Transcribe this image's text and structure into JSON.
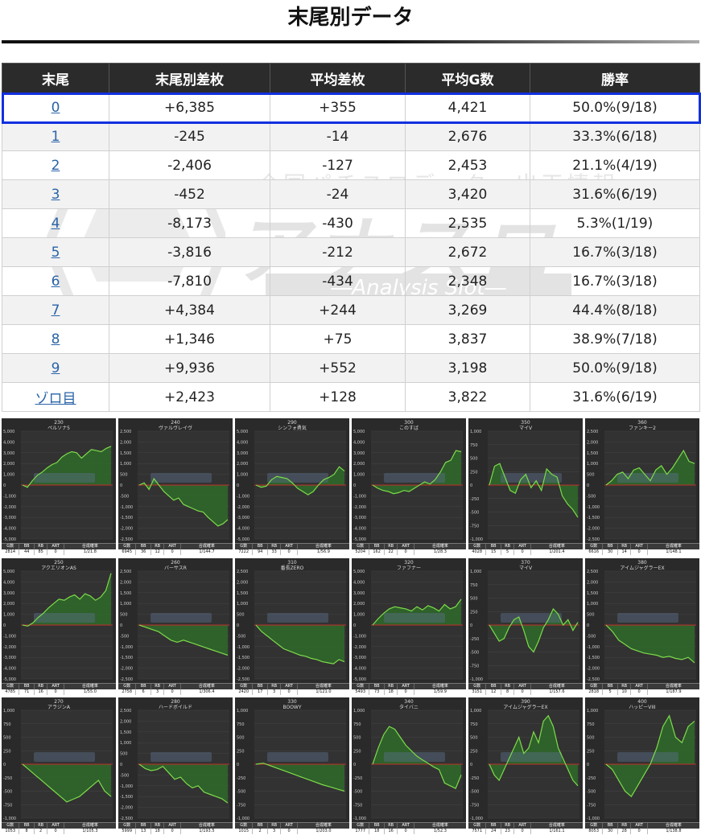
{
  "page": {
    "title": "末尾別データ"
  },
  "table": {
    "headers": [
      "末尾",
      "末尾別差枚",
      "平均差枚",
      "平均G数",
      "勝率"
    ],
    "rows": [
      {
        "tail": "0",
        "total": "+6,385",
        "avg": "+355",
        "games": "4,421",
        "win": "50.0%(9/18)"
      },
      {
        "tail": "1",
        "total": "-245",
        "avg": "-14",
        "games": "2,676",
        "win": "33.3%(6/18)"
      },
      {
        "tail": "2",
        "total": "-2,406",
        "avg": "-127",
        "games": "2,453",
        "win": "21.1%(4/19)"
      },
      {
        "tail": "3",
        "total": "-452",
        "avg": "-24",
        "games": "3,420",
        "win": "31.6%(6/19)"
      },
      {
        "tail": "4",
        "total": "-8,173",
        "avg": "-430",
        "games": "2,535",
        "win": "5.3%(1/19)"
      },
      {
        "tail": "5",
        "total": "-3,816",
        "avg": "-212",
        "games": "2,672",
        "win": "16.7%(3/18)"
      },
      {
        "tail": "6",
        "total": "-7,810",
        "avg": "-434",
        "games": "2,348",
        "win": "16.7%(3/18)"
      },
      {
        "tail": "7",
        "total": "+4,384",
        "avg": "+244",
        "games": "3,269",
        "win": "44.4%(8/18)"
      },
      {
        "tail": "8",
        "total": "+1,346",
        "avg": "+75",
        "games": "3,837",
        "win": "38.9%(7/18)"
      },
      {
        "tail": "9",
        "total": "+9,936",
        "avg": "+552",
        "games": "3,198",
        "win": "50.0%(9/18)"
      },
      {
        "tail": "ゾロ目",
        "total": "+2,423",
        "avg": "+128",
        "games": "3,822",
        "win": "31.6%(6/19)"
      }
    ]
  },
  "watermark": {
    "top_text": "全国パチスロデータ・出玉情報",
    "logo_text": "アナスロ",
    "sub_text": "―Analysis Slot―"
  },
  "colors": {
    "header_bg": "#2b2b2b",
    "highlight_border": "#1230e0",
    "link": "#2a63a8",
    "chart_bg": "#2a2a2a",
    "chart_line": "#7ddc4a",
    "chart_fill": "#2f6a2a",
    "zero_line": "#c0302a"
  },
  "footer_headers": [
    "G数",
    "BB",
    "RB",
    "ART",
    "合成確率"
  ],
  "chart_data": [
    {
      "type": "area",
      "machine_no": "230",
      "title": "ペルソナ5",
      "yticks": [
        "5,000",
        "4,000",
        "3,000",
        "2,000",
        "1,000",
        "0",
        "-1,000",
        "-2,000",
        "-3,000",
        "-4,000",
        "-5,000"
      ],
      "ylim": [
        -5000,
        5000
      ],
      "values": [
        0,
        -200,
        400,
        900,
        1200,
        1600,
        1900,
        2100,
        2600,
        2900,
        3100,
        3000,
        2500,
        2900,
        3300,
        3200,
        3100,
        3400,
        3600
      ],
      "stats": [
        "2814",
        "44",
        "85",
        "0",
        "1/21.8"
      ]
    },
    {
      "type": "area",
      "machine_no": "240",
      "title": "ヴァルヴレイヴ",
      "yticks": [
        "2,500",
        "2,000",
        "1,500",
        "1,000",
        "500",
        "0",
        "-500",
        "-1,000",
        "-1,500",
        "-2,000",
        "-2,500"
      ],
      "ylim": [
        -2500,
        2500
      ],
      "values": [
        0,
        100,
        -200,
        300,
        0,
        -300,
        -500,
        -700,
        -600,
        -900,
        -1000,
        -1100,
        -1200,
        -1250,
        -1500,
        -1700,
        -1900,
        -1800,
        -1600
      ],
      "stats": [
        "6945",
        "36",
        "12",
        "0",
        "1/144.7"
      ]
    },
    {
      "type": "area",
      "machine_no": "290",
      "title": "シンフォ勇気",
      "yticks": [
        "5,000",
        "4,000",
        "3,000",
        "2,000",
        "1,000",
        "0",
        "-1,000",
        "-2,000",
        "-3,000",
        "-4,000",
        "-5,000"
      ],
      "ylim": [
        -5000,
        5000
      ],
      "values": [
        0,
        -200,
        -100,
        500,
        800,
        700,
        600,
        200,
        -300,
        -600,
        -900,
        -600,
        0,
        500,
        700,
        1000,
        1700,
        1300
      ],
      "stats": [
        "7222",
        "94",
        "33",
        "0",
        "1/56.9"
      ]
    },
    {
      "type": "area",
      "machine_no": "300",
      "title": "このすば",
      "yticks": [
        "5,000",
        "4,000",
        "3,000",
        "2,000",
        "1,000",
        "0",
        "-1,000",
        "-2,000",
        "-3,000",
        "-4,000",
        "-5,000"
      ],
      "ylim": [
        -5000,
        5000
      ],
      "values": [
        0,
        -300,
        -500,
        -600,
        -800,
        -700,
        -500,
        -600,
        -300,
        0,
        300,
        100,
        500,
        1200,
        2100,
        2300,
        3200,
        3100
      ],
      "stats": [
        "5204",
        "162",
        "22",
        "0",
        "1/28.3"
      ]
    },
    {
      "type": "area",
      "machine_no": "350",
      "title": "マイV",
      "yticks": [
        "1,000",
        "750",
        "500",
        "250",
        "0",
        "-250",
        "-500",
        "-750",
        "-1,000"
      ],
      "ylim": [
        -1000,
        1000
      ],
      "values": [
        0,
        350,
        400,
        150,
        -100,
        -150,
        100,
        200,
        -50,
        80,
        -100,
        300,
        200,
        150,
        -200,
        -350,
        -450,
        -600
      ],
      "stats": [
        "4028",
        "15",
        "5",
        "0",
        "1/201.4"
      ]
    },
    {
      "type": "area",
      "machine_no": "360",
      "title": "ファンキー2",
      "yticks": [
        "2,500",
        "2,000",
        "1,500",
        "1,000",
        "500",
        "0",
        "-500",
        "-1,000",
        "-1,500",
        "-2,000",
        "-2,500"
      ],
      "ylim": [
        -2500,
        2500
      ],
      "values": [
        0,
        200,
        500,
        600,
        300,
        700,
        800,
        500,
        200,
        700,
        900,
        500,
        800,
        1200,
        1600,
        1100,
        1000
      ],
      "stats": [
        "6616",
        "30",
        "14",
        "0",
        "1/148.1"
      ]
    },
    {
      "type": "area",
      "machine_no": "250",
      "title": "アクエリオンAS",
      "yticks": [
        "5,000",
        "4,000",
        "3,000",
        "2,000",
        "1,000",
        "0",
        "-1,000",
        "-2,000",
        "-3,000",
        "-4,000",
        "-5,000"
      ],
      "ylim": [
        -5000,
        5000
      ],
      "values": [
        0,
        -100,
        200,
        700,
        1100,
        1600,
        2000,
        2400,
        2300,
        2600,
        2800,
        2400,
        2900,
        2700,
        2300,
        2600,
        3200,
        4800
      ],
      "stats": [
        "4785",
        "71",
        "16",
        "0",
        "1/55.0"
      ]
    },
    {
      "type": "area",
      "machine_no": "260",
      "title": "バーサスR",
      "yticks": [
        "2,500",
        "2,000",
        "1,500",
        "1,000",
        "500",
        "0",
        "-500",
        "-1,000",
        "-1,500",
        "-2,000",
        "-2,500"
      ],
      "ylim": [
        -2500,
        2500
      ],
      "values": [
        0,
        -100,
        -200,
        -300,
        -500,
        -700,
        -800,
        -700,
        -800,
        -900,
        -1000,
        -1100,
        -1200,
        -1300,
        -1400
      ],
      "stats": [
        "2758",
        "6",
        "3",
        "0",
        "1/306.4"
      ]
    },
    {
      "type": "area",
      "machine_no": "310",
      "title": "番長ZERO",
      "yticks": [
        "2,500",
        "2,000",
        "1,500",
        "1,000",
        "500",
        "0",
        "-500",
        "-1,000",
        "-1,500",
        "-2,000",
        "-2,500"
      ],
      "ylim": [
        -2500,
        2500
      ],
      "values": [
        0,
        -300,
        -500,
        -700,
        -900,
        -1100,
        -1200,
        -1300,
        -1400,
        -1450,
        -1550,
        -1600,
        -1700,
        -1750,
        -1800,
        -1600,
        -1700
      ],
      "stats": [
        "2420",
        "17",
        "3",
        "0",
        "1/121.0"
      ]
    },
    {
      "type": "area",
      "machine_no": "320",
      "title": "ファフナー",
      "yticks": [
        "5,000",
        "4,000",
        "3,000",
        "2,000",
        "1,000",
        "0",
        "-1,000",
        "-2,000",
        "-3,000",
        "-4,000",
        "-5,000"
      ],
      "ylim": [
        -5000,
        5000
      ],
      "values": [
        0,
        600,
        1100,
        1500,
        1700,
        1600,
        1500,
        1300,
        1700,
        1400,
        1800,
        1600,
        1300,
        1900,
        1500,
        1700,
        2400
      ],
      "stats": [
        "5493",
        "73",
        "18",
        "0",
        "1/59.9"
      ]
    },
    {
      "type": "area",
      "machine_no": "370",
      "title": "マイV",
      "yticks": [
        "1,000",
        "750",
        "500",
        "250",
        "0",
        "-250",
        "-500",
        "-750",
        "-1,000"
      ],
      "ylim": [
        -1000,
        1000
      ],
      "values": [
        0,
        -150,
        -300,
        -250,
        -50,
        100,
        150,
        -100,
        -400,
        -500,
        -300,
        -50,
        100,
        300,
        200,
        0,
        100,
        -100,
        50
      ],
      "stats": [
        "3151",
        "12",
        "8",
        "0",
        "1/157.6"
      ]
    },
    {
      "type": "area",
      "machine_no": "380",
      "title": "アイムジャグラーEX",
      "yticks": [
        "2,500",
        "2,000",
        "1,500",
        "1,000",
        "500",
        "0",
        "-500",
        "-1,000",
        "-1,500",
        "-2,000",
        "-2,500"
      ],
      "ylim": [
        -2500,
        2500
      ],
      "values": [
        0,
        -300,
        -700,
        -900,
        -1100,
        -1200,
        -1300,
        -1350,
        -1400,
        -1500,
        -1450,
        -1550,
        -1600,
        -1500,
        -1750
      ],
      "stats": [
        "2818",
        "5",
        "10",
        "0",
        "1/187.9"
      ]
    },
    {
      "type": "area",
      "machine_no": "270",
      "title": "アラジンA",
      "yticks": [
        "1,000",
        "750",
        "500",
        "250",
        "0",
        "-250",
        "-500",
        "-750",
        "-1,000"
      ],
      "ylim": [
        -1000,
        1000
      ],
      "values": [
        0,
        -100,
        -200,
        -300,
        -400,
        -500,
        -600,
        -700,
        -650,
        -600,
        -500,
        -400,
        -300,
        -500,
        -600
      ],
      "stats": [
        "1053",
        "8",
        "2",
        "0",
        "1/105.3"
      ]
    },
    {
      "type": "area",
      "machine_no": "280",
      "title": "ハードボイルド",
      "yticks": [
        "2,500",
        "2,000",
        "1,500",
        "1,000",
        "500",
        "0",
        "-500",
        "-1,000",
        "-1,500",
        "-2,000",
        "-2,500"
      ],
      "ylim": [
        -2500,
        2500
      ],
      "values": [
        0,
        -200,
        -300,
        -250,
        -100,
        -400,
        -700,
        -600,
        -900,
        -1100,
        -1000,
        -1300,
        -1400,
        -1500,
        -1600,
        -1800
      ],
      "stats": [
        "5999",
        "13",
        "18",
        "0",
        "1/193.5"
      ]
    },
    {
      "type": "area",
      "machine_no": "330",
      "title": "BOOWY",
      "yticks": [
        "1,000",
        "750",
        "500",
        "250",
        "0",
        "-250",
        "-500",
        "-750",
        "-1,000"
      ],
      "ylim": [
        -1000,
        1000
      ],
      "values": [
        0,
        20,
        -30,
        -80,
        -130,
        -180,
        -230,
        -280,
        -330,
        -380,
        -420,
        -460,
        -500
      ],
      "stats": [
        "1015",
        "2",
        "3",
        "0",
        "1/203.0"
      ]
    },
    {
      "type": "area",
      "machine_no": "340",
      "title": "タイバニ",
      "yticks": [
        "1,000",
        "750",
        "500",
        "250",
        "0",
        "-250",
        "-500",
        "-750",
        "-1,000"
      ],
      "ylim": [
        -1000,
        1000
      ],
      "values": [
        0,
        300,
        550,
        700,
        650,
        500,
        350,
        250,
        150,
        80,
        20,
        -50,
        -100,
        -350,
        -400,
        -450,
        -200
      ],
      "stats": [
        "1777",
        "18",
        "16",
        "0",
        "1/52.3"
      ]
    },
    {
      "type": "area",
      "machine_no": "390",
      "title": "アイムジャグラーEX",
      "yticks": [
        "1,000",
        "750",
        "500",
        "250",
        "0",
        "-250",
        "-500",
        "-750",
        "-1,000"
      ],
      "ylim": [
        -1000,
        1000
      ],
      "values": [
        0,
        -200,
        -300,
        -100,
        100,
        300,
        500,
        200,
        300,
        600,
        400,
        800,
        900,
        700,
        300,
        100,
        -100,
        -300,
        -400
      ],
      "stats": [
        "7571",
        "24",
        "23",
        "0",
        "1/161.1"
      ]
    },
    {
      "type": "area",
      "machine_no": "400",
      "title": "ハッピーVIII",
      "yticks": [
        "1,000",
        "750",
        "500",
        "250",
        "0",
        "-250",
        "-500",
        "-750",
        "-1,000"
      ],
      "ylim": [
        -1000,
        1000
      ],
      "values": [
        0,
        -100,
        -300,
        -500,
        -600,
        -400,
        -200,
        0,
        300,
        700,
        900,
        500,
        400,
        700,
        800
      ],
      "stats": [
        "8053",
        "30",
        "28",
        "0",
        "1/138.8"
      ]
    }
  ]
}
